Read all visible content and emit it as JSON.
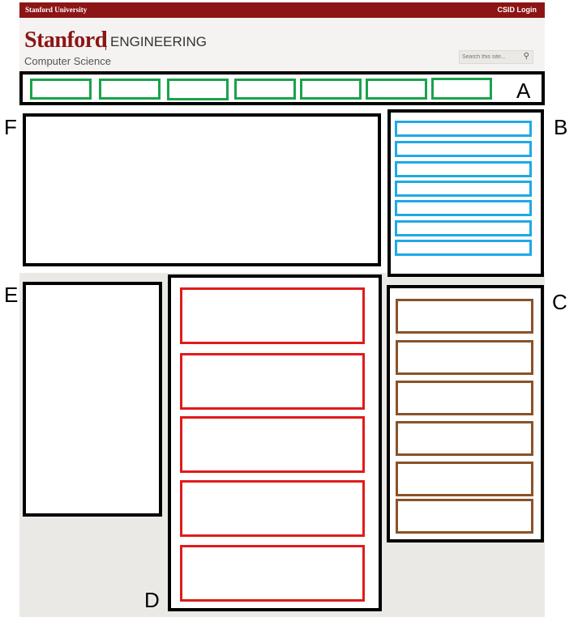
{
  "topbar": {
    "university": "Stanford University",
    "login": "CSID Login"
  },
  "header": {
    "logo_stanford": "Stanford",
    "logo_engineering": "ENGINEERING",
    "department": "Computer Science",
    "search_placeholder": "Search this site..."
  },
  "labels": {
    "a": "A",
    "b": "B",
    "c": "C",
    "d": "D",
    "e": "E",
    "f": "F"
  },
  "colors": {
    "brand": "#8c1515",
    "nav_items": "#1aa34a",
    "sidebar_links": "#1ea9e6",
    "events": "#8a5228",
    "news": "#e01b1b"
  }
}
